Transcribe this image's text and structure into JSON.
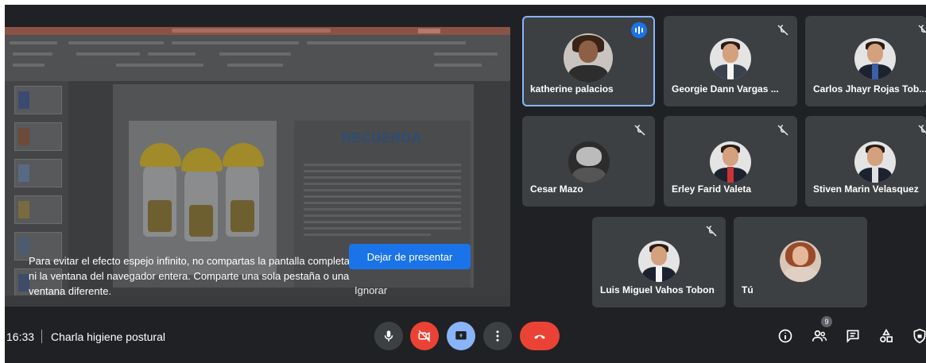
{
  "notice": {
    "message": "Para evitar el efecto espejo infinito, no compartas la pantalla completa ni la ventana del navegador entera. Comparte una sola pestaña o una ventana diferente.",
    "stop_presenting_label": "Dejar de presentar",
    "ignore_label": "Ignorar"
  },
  "shared_slide": {
    "heading": "RECUERDA"
  },
  "participants": [
    {
      "name": "katherine palacios",
      "speaking": true,
      "muted": false
    },
    {
      "name": "Georgie Dann Vargas ...",
      "muted": true
    },
    {
      "name": "Carlos Jhayr Rojas Tob...",
      "muted": true
    },
    {
      "name": "Cesar Mazo",
      "muted": true
    },
    {
      "name": "Erley Farid Valeta",
      "muted": true
    },
    {
      "name": "Stiven Marin Velasquez",
      "muted": true
    },
    {
      "name": "Luis Miguel Vahos Tobon",
      "muted": true
    },
    {
      "name": "Tú",
      "muted": false
    }
  ],
  "meeting": {
    "time": "16:33",
    "title": "Charla higiene postural",
    "participant_count": "9"
  },
  "colors": {
    "background": "#202124",
    "tile": "#3c4043",
    "accent_blue": "#1a73e8",
    "active_outline": "#8ab4f8",
    "danger_red": "#ea4335"
  },
  "icons": {
    "controls": [
      "mic-icon",
      "camera-off-icon",
      "present-icon",
      "more-options-icon",
      "hang-up-icon"
    ],
    "right": [
      "info-icon",
      "people-icon",
      "chat-icon",
      "activities-icon",
      "host-controls-icon"
    ]
  }
}
